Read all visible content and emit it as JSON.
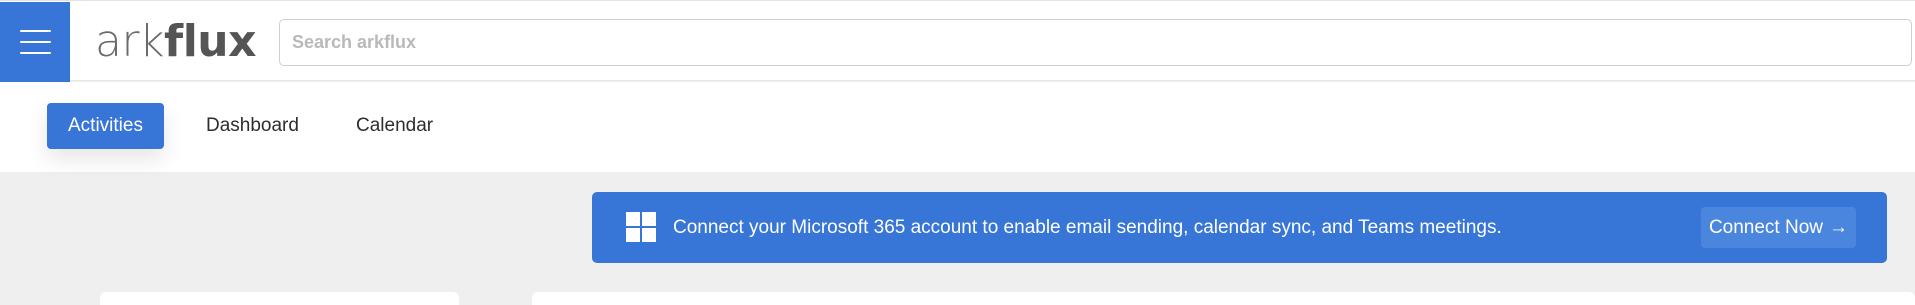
{
  "app": {
    "logo_regular": "ark",
    "logo_bold": "flux"
  },
  "search": {
    "placeholder": "Search arkflux",
    "value": ""
  },
  "tabs": [
    {
      "label": "Activities",
      "active": true
    },
    {
      "label": "Dashboard",
      "active": false
    },
    {
      "label": "Calendar",
      "active": false
    }
  ],
  "banner": {
    "message": "Connect your Microsoft 365 account to enable email sending, calendar sync, and Teams meetings.",
    "button_label": "Connect Now",
    "button_icon": "arrow-right-icon",
    "icon": "windows-icon"
  },
  "colors": {
    "accent": "#3775d6",
    "background": "#efefef"
  }
}
